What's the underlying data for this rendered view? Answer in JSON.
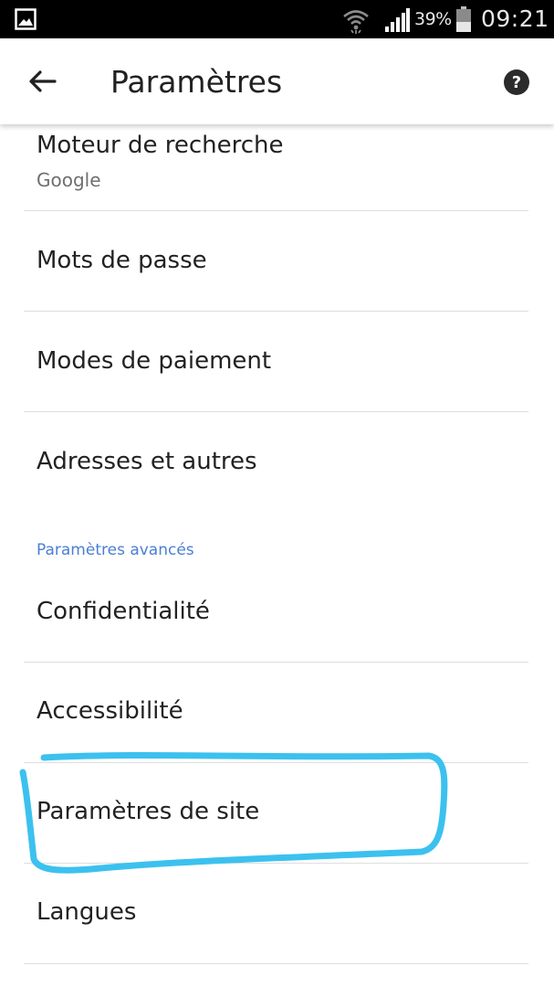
{
  "status_bar": {
    "battery_percent": "39%",
    "time": "09:21",
    "icons": [
      "gallery-icon",
      "wifi-icon",
      "signal-icon",
      "battery-icon"
    ]
  },
  "app_bar": {
    "title": "Paramètres",
    "back_icon": "arrow-back-icon",
    "help_icon": "help-icon"
  },
  "settings": {
    "search_engine": {
      "label": "Moteur de recherche",
      "value": "Google"
    },
    "passwords": {
      "label": "Mots de passe"
    },
    "payment_methods": {
      "label": "Modes de paiement"
    },
    "addresses": {
      "label": "Adresses et autres"
    },
    "advanced_header": "Paramètres avancés",
    "privacy": {
      "label": "Confidentialité"
    },
    "accessibility": {
      "label": "Accessibilité"
    },
    "site_settings": {
      "label": "Paramètres de site"
    },
    "languages": {
      "label": "Langues"
    }
  },
  "colors": {
    "status_bar_bg": "#000000",
    "section_header": "#4a7fd4",
    "annotation_stroke": "#3cc1ef",
    "divider": "#dedede"
  }
}
